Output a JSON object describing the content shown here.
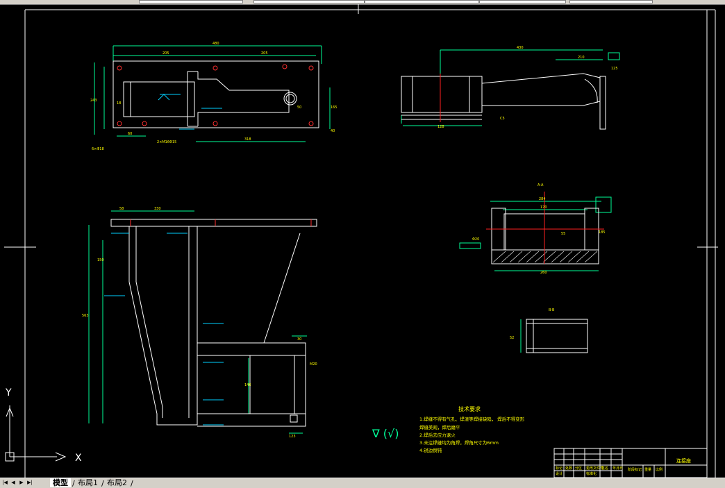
{
  "window": {
    "tabs": [
      {
        "label": "模型",
        "active": true
      },
      {
        "label": "布局1",
        "active": false
      },
      {
        "label": "布局2",
        "active": false
      }
    ]
  },
  "ucs": {
    "x_label": "X",
    "y_label": "Y"
  },
  "colors": {
    "background": "#000000",
    "geometry": "#ffffff",
    "dimension": "#00ff99",
    "centerline": "#ff2020",
    "text": "#ffff00",
    "weld": "#00d0ff"
  },
  "drawing": {
    "top_view": {
      "dims": [
        "480",
        "205",
        "205",
        "318",
        "60",
        "165",
        "243",
        "40",
        "50",
        "18",
        "6×Φ18",
        "2×M16Φ15"
      ]
    },
    "front_elevation": {
      "dims": [
        "430",
        "210",
        "C5",
        "128",
        "125"
      ]
    },
    "section_aa": {
      "label": "A-A",
      "dims": [
        "284",
        "170",
        "260",
        "55",
        "185",
        "Φ20"
      ]
    },
    "section_bb": {
      "label": "B-B",
      "dims": [
        "52"
      ]
    },
    "side_view": {
      "dims": [
        "58",
        "330",
        "30",
        "146",
        "563",
        "150",
        "123",
        "M20"
      ]
    },
    "roughness_symbol": "∇ (√)",
    "technical_requirements": {
      "title": "技术要求",
      "items": [
        "1.焊缝不得有气孔、焊渣等焊接缺陷， 焊后不得变形",
        "焊缝美观，焊后磨平",
        "2.焊后去应力退火",
        "3.未注焊缝均为角焊，焊角尺寸为6mm",
        "4.锐边倒钝"
      ]
    },
    "title_block": {
      "part_name": "连接座",
      "headers": [
        "标记",
        "处数",
        "分区",
        "更改文件号",
        "签名",
        "年月日"
      ],
      "designer": "设计",
      "standardization": "标准化",
      "stage_mark": "阶段标记",
      "weight": "重量",
      "scale": "比例"
    }
  }
}
